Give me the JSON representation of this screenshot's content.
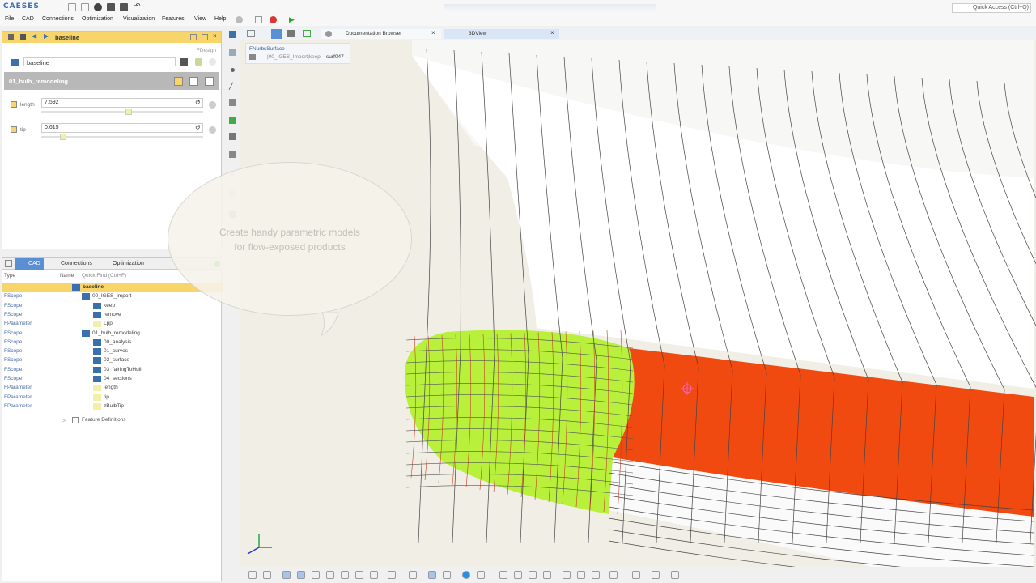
{
  "app": {
    "logo": "CAESES"
  },
  "menu": [
    "File",
    "CAD",
    "Connections",
    "Optimization",
    "Visualization",
    "Features",
    "View",
    "Help"
  ],
  "quick_access": "Quick Access (Ctrl+Q)",
  "left_top": {
    "title": "baseline",
    "design_name": "baseline",
    "design_type": "FDesign",
    "model_name": "01_bulb_remodeling",
    "params": [
      {
        "label": "length",
        "value": "7.592",
        "level": 0.54
      },
      {
        "label": "tip",
        "value": "0.615",
        "level": 0.12
      }
    ]
  },
  "bottom_tabs": {
    "cad": "CAD",
    "connections": "Connections",
    "optimization": "Optimization"
  },
  "tree": {
    "col_type": "Type",
    "col_name": "Name",
    "quick_find": "Quick Find (Ctrl+F)",
    "rows": [
      {
        "type": "",
        "name": "baseline",
        "indent": 0,
        "root": true
      },
      {
        "type": "FScope",
        "name": "00_IGES_Import",
        "indent": 1
      },
      {
        "type": "FScope",
        "name": "keep",
        "indent": 2
      },
      {
        "type": "FScope",
        "name": "remove",
        "indent": 2
      },
      {
        "type": "FParameter",
        "name": "Lpp",
        "indent": 2
      },
      {
        "type": "FScope",
        "name": "01_bulb_remodeling",
        "indent": 1
      },
      {
        "type": "FScope",
        "name": "00_analysis",
        "indent": 2
      },
      {
        "type": "FScope",
        "name": "01_curves",
        "indent": 2
      },
      {
        "type": "FScope",
        "name": "02_surface",
        "indent": 2
      },
      {
        "type": "FScope",
        "name": "03_fairingToHull",
        "indent": 2
      },
      {
        "type": "FScope",
        "name": "04_sections",
        "indent": 2
      },
      {
        "type": "FParameter",
        "name": "length",
        "indent": 2
      },
      {
        "type": "FParameter",
        "name": "tip",
        "indent": 2
      },
      {
        "type": "FParameter",
        "name": "zBulbTip",
        "indent": 2
      }
    ],
    "feature_definitions": "Feature Definitions"
  },
  "viewer_tabs": {
    "doc": "Documentation Browser",
    "view3d": "3DView"
  },
  "selection": {
    "type": "FNurbsSurface",
    "path": "|00_IGES_Import|keep|",
    "name": "surf047"
  },
  "bubble": {
    "line1": "Create handy parametric models",
    "line2": "for flow-exposed products"
  },
  "colors": {
    "accent": "#f7d56a",
    "bulb_green": "#b8f03c",
    "strip_orange": "#f04a10",
    "tab_blue": "#5b8fd4"
  }
}
